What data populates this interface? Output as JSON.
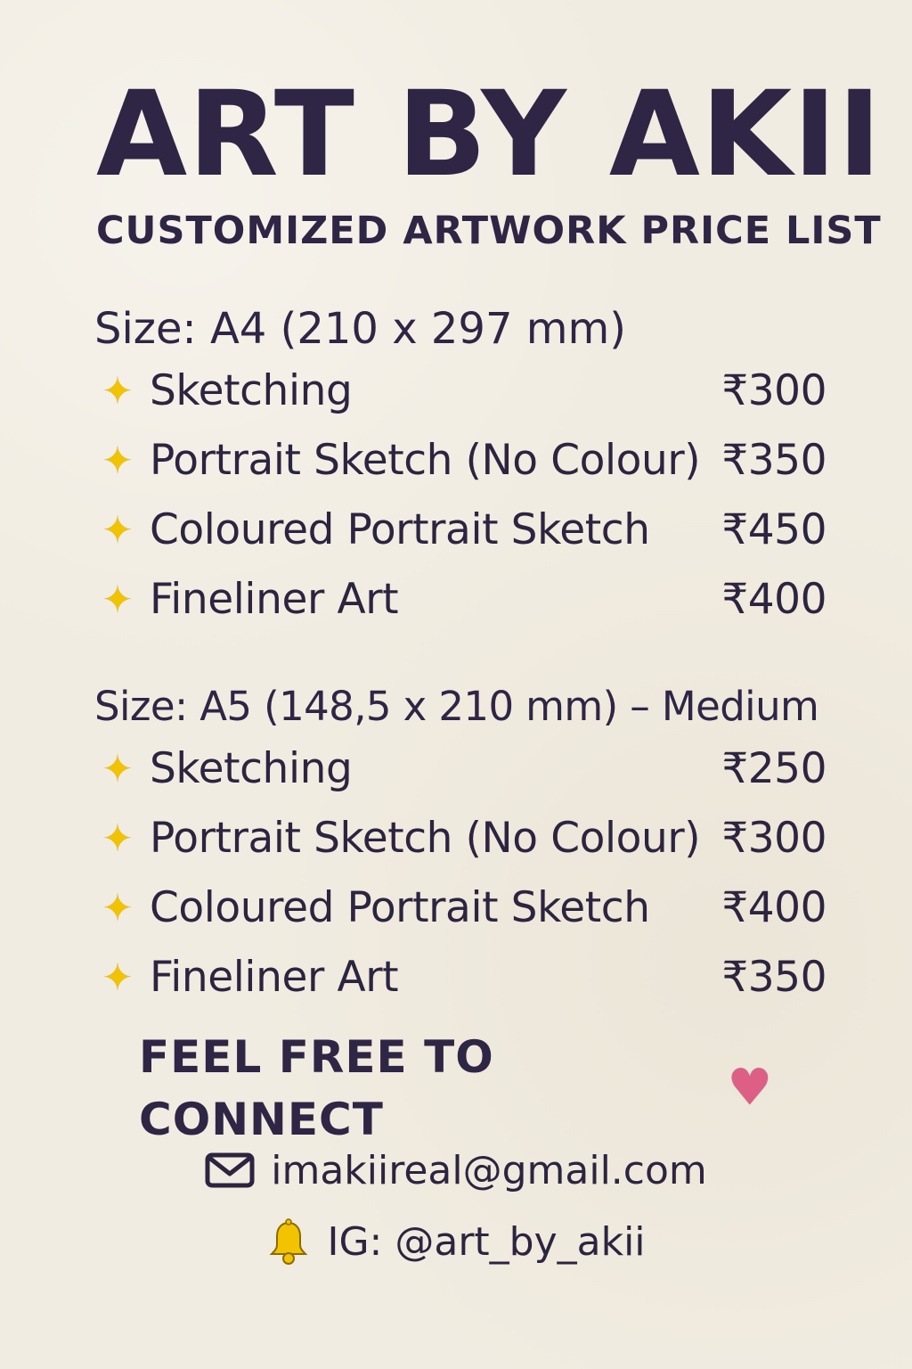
{
  "header": {
    "title": "ART BY AKII",
    "subtitle": "CUSTOMIZED ARTWORK PRICE LIST"
  },
  "sections": [
    {
      "heading": "Size: A4 (210 x 297 mm)",
      "items": [
        {
          "icon": "sparkle-icon",
          "name": "Sketching",
          "price": "₹300"
        },
        {
          "icon": "sparkle-icon",
          "name": "Portrait Sketch (No Colour)",
          "price": "₹350"
        },
        {
          "icon": "sparkle-icon",
          "name": "Coloured Portrait Sketch",
          "price": "₹450"
        },
        {
          "icon": "sparkle-icon",
          "name": "Fineliner Art",
          "price": "₹400"
        }
      ]
    },
    {
      "heading": "Size: A5 (148,5 x 210 mm) – Medium",
      "items": [
        {
          "icon": "sparkle-icon",
          "name": "Sketching",
          "price": "₹250"
        },
        {
          "icon": "sparkle-icon",
          "name": "Portrait Sketch (No Colour)",
          "price": "₹300"
        },
        {
          "icon": "sparkle-icon",
          "name": "Coloured Portrait Sketch",
          "price": "₹400"
        },
        {
          "icon": "sparkle-icon",
          "name": "Fineliner Art",
          "price": "₹350"
        }
      ]
    }
  ],
  "contact": {
    "heading": "FEEL FREE TO CONNECT",
    "email": "imakiireal@gmail.com",
    "instagram": "IG: @art_by_akii",
    "icons": {
      "heart": "heart-icon",
      "email": "envelope-icon",
      "instagram": "bell-icon"
    }
  },
  "colors": {
    "background": "#f1ece1",
    "text": "#2d2440",
    "sparkle": "#f2c300",
    "heart": "#de5f85",
    "bell": "#f2c300"
  }
}
